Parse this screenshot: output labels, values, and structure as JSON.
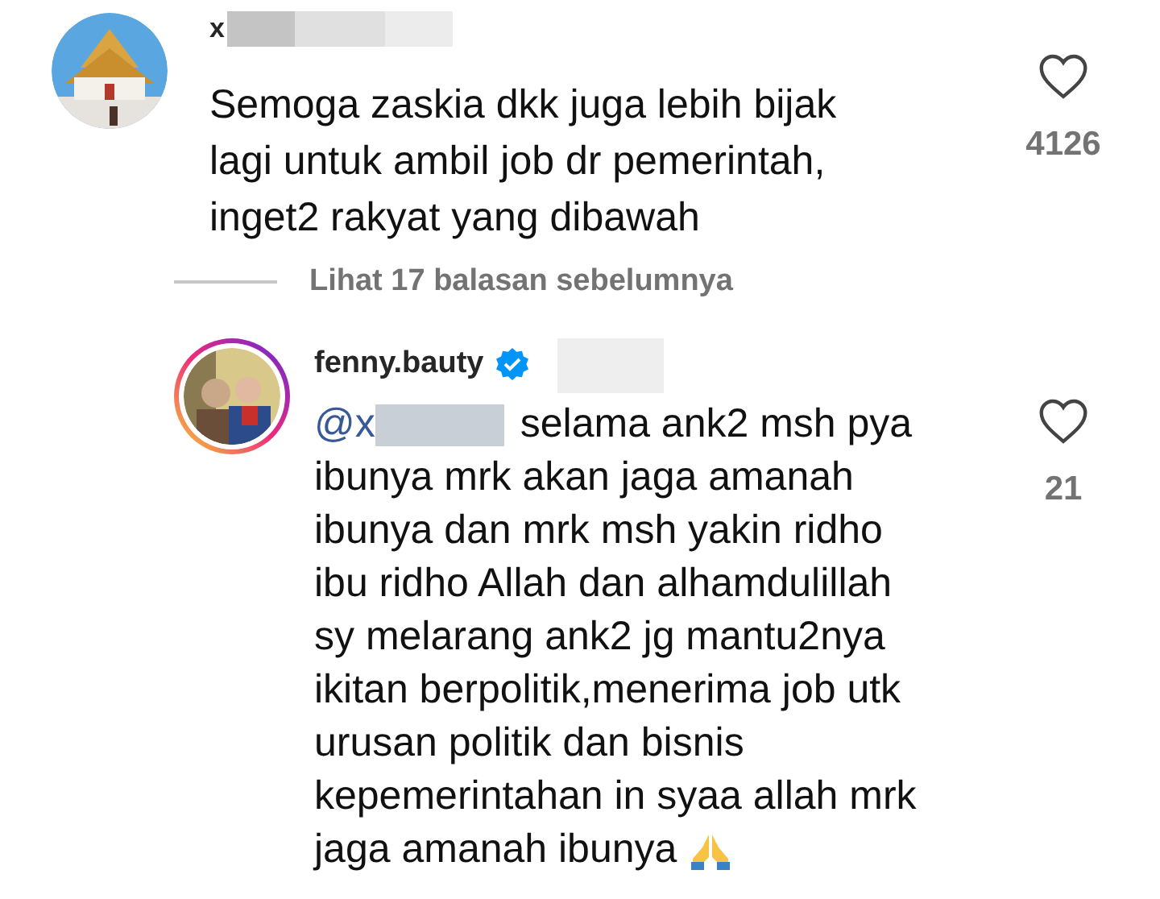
{
  "comment": {
    "username": "x",
    "lines": [
      "Semoga zaskia dkk juga lebih bijak",
      "lagi untuk ambil job dr pemerintah,",
      "inget2 rakyat yang dibawah"
    ],
    "liked": false,
    "like_count": "4126"
  },
  "view_replies": "Lihat 17 balasan sebelumnya",
  "reply": {
    "username": "fenny.bauty",
    "verified": true,
    "mention": "@x",
    "lines": [
      "selama ank2 msh pya",
      "ibunya mrk akan jaga amanah",
      "ibunya dan mrk msh yakin ridho",
      "ibu ridho Allah dan alhamdulillah",
      "sy melarang ank2 jg mantu2nya",
      "ikitan berpolitik,menerima job utk",
      "urusan politik dan bisnis",
      "kepemerintahan in syaa allah mrk",
      "jaga amanah ibunya"
    ],
    "liked": false,
    "like_count": "21"
  }
}
